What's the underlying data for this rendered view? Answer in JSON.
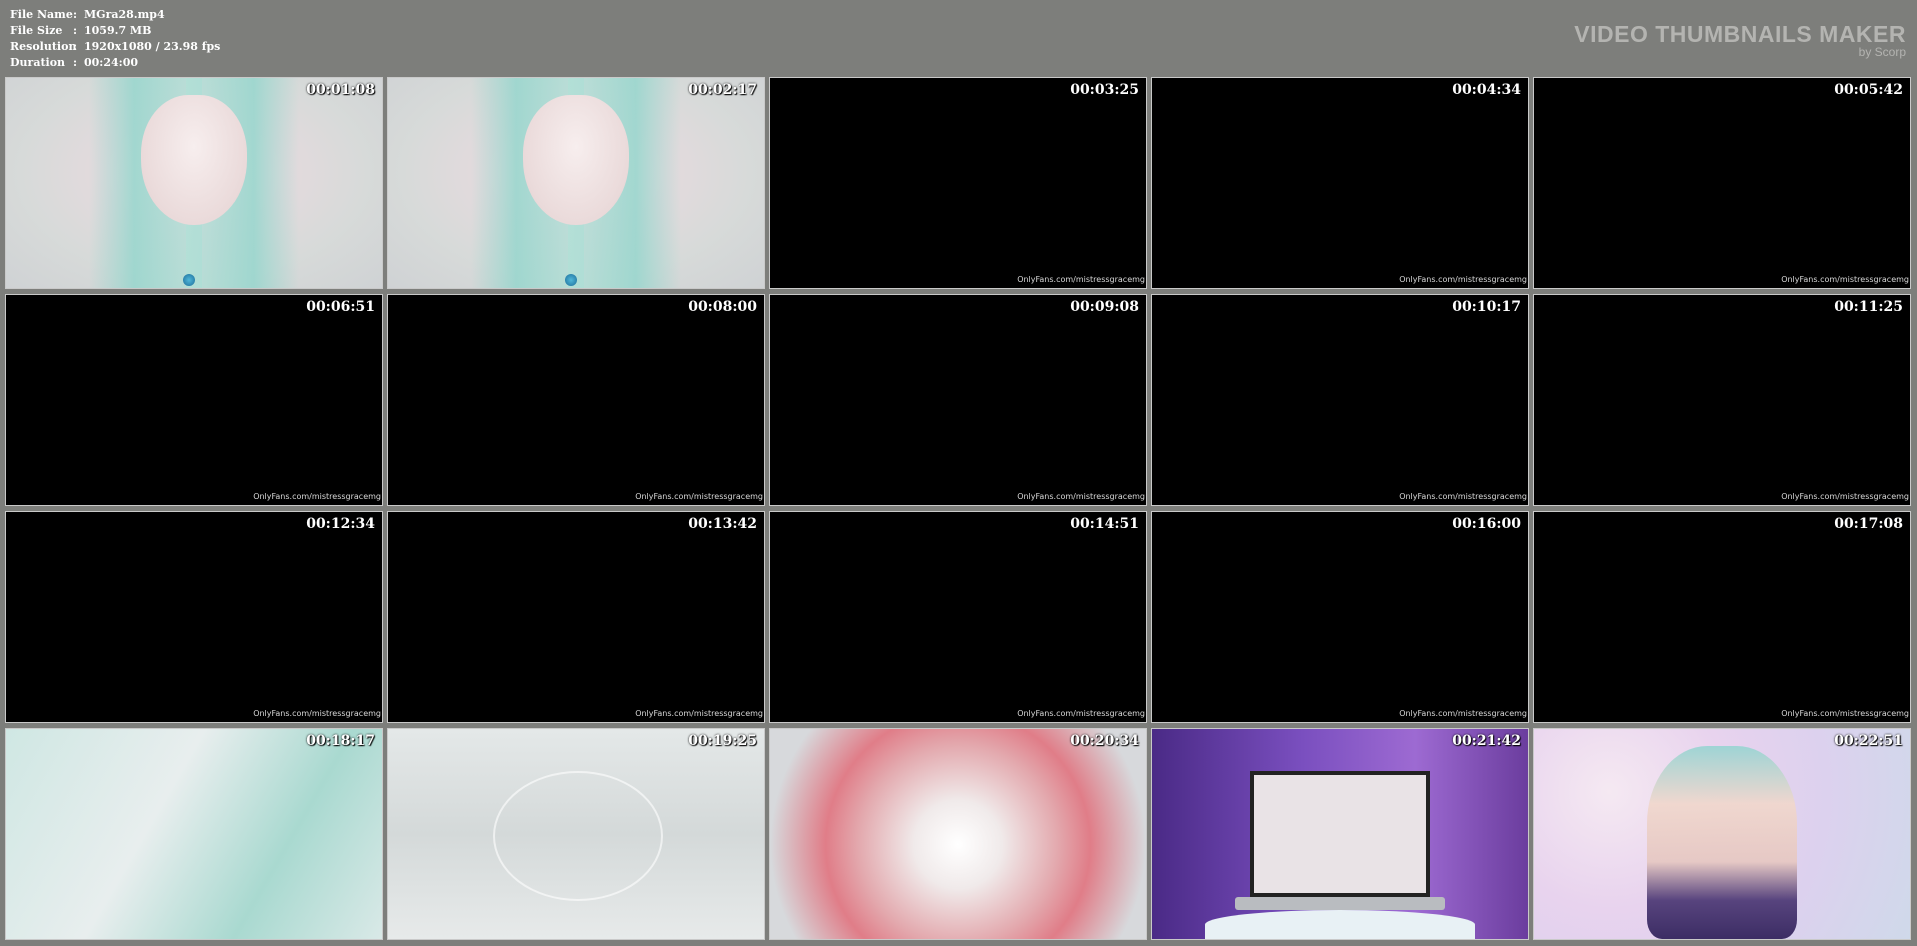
{
  "meta": {
    "file_name_label": "File Name",
    "file_name": "MGra28.mp4",
    "file_size_label": "File Size",
    "file_size": "1059.7 MB",
    "resolution_label": "Resolution",
    "resolution": "1920x1080 / 23.98 fps",
    "duration_label": "Duration",
    "duration": "00:24:00",
    "separator": ":"
  },
  "logo": {
    "title": "VIDEO THUMBNAILS MAKER",
    "subtitle": "by Scorp"
  },
  "watermark": "OnlyFans.com/mistressgracemg",
  "thumbnails": [
    {
      "time": "00:01:08",
      "scene": "face"
    },
    {
      "time": "00:02:17",
      "scene": "face"
    },
    {
      "time": "00:03:25",
      "scene": "black"
    },
    {
      "time": "00:04:34",
      "scene": "black"
    },
    {
      "time": "00:05:42",
      "scene": "black"
    },
    {
      "time": "00:06:51",
      "scene": "black"
    },
    {
      "time": "00:08:00",
      "scene": "black"
    },
    {
      "time": "00:09:08",
      "scene": "black"
    },
    {
      "time": "00:10:17",
      "scene": "black"
    },
    {
      "time": "00:11:25",
      "scene": "black"
    },
    {
      "time": "00:12:34",
      "scene": "black"
    },
    {
      "time": "00:13:42",
      "scene": "black"
    },
    {
      "time": "00:14:51",
      "scene": "black"
    },
    {
      "time": "00:16:00",
      "scene": "black"
    },
    {
      "time": "00:17:08",
      "scene": "black"
    },
    {
      "time": "00:18:17",
      "scene": "closeup"
    },
    {
      "time": "00:19:25",
      "scene": "collage"
    },
    {
      "time": "00:20:34",
      "scene": "aura"
    },
    {
      "time": "00:21:42",
      "scene": "laptop"
    },
    {
      "time": "00:22:51",
      "scene": "bokeh"
    }
  ]
}
